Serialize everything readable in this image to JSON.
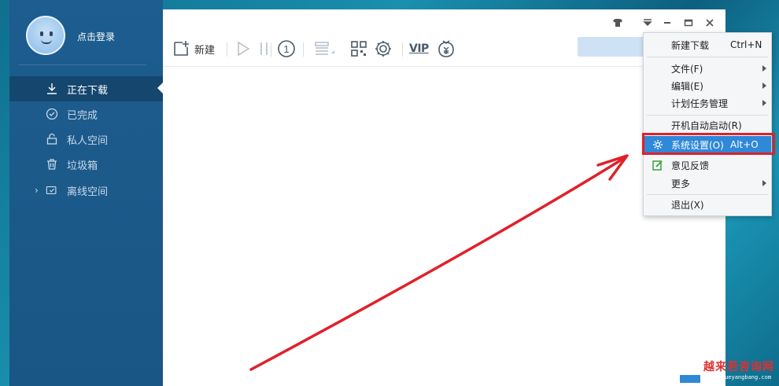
{
  "sidebar": {
    "login_text": "点击登录",
    "items": [
      {
        "label": "正在下载",
        "icon": "download-icon",
        "active": true
      },
      {
        "label": "已完成",
        "icon": "check-circle-icon"
      },
      {
        "label": "私人空间",
        "icon": "lock-icon"
      },
      {
        "label": "垃圾箱",
        "icon": "trash-icon"
      },
      {
        "label": "离线空间",
        "icon": "cloud-icon",
        "expandable": true
      }
    ]
  },
  "toolbar": {
    "new_label": "新建",
    "vip_label": "VIP",
    "limit_label": "1"
  },
  "menu": {
    "items": [
      {
        "label": "新建下载",
        "shortcut": "Ctrl+N"
      },
      {
        "label": "文件(F)",
        "submenu": true
      },
      {
        "label": "编辑(E)",
        "submenu": true
      },
      {
        "label": "计划任务管理",
        "submenu": true
      },
      {
        "label": "开机自动启动(R)"
      },
      {
        "label": "系统设置(O)",
        "shortcut": "Alt+O",
        "highlighted": true,
        "icon": "gear-icon"
      },
      {
        "label": "意见反馈",
        "icon": "edit-icon"
      },
      {
        "label": "更多",
        "submenu": true
      },
      {
        "label": "退出(X)"
      }
    ]
  },
  "watermark": {
    "text": "越来若咨询网",
    "url": "www.yueyangbang.com"
  },
  "colors": {
    "sidebar": "#1d5d8f",
    "highlight": "#2f88d8",
    "annotation": "#e0202a"
  }
}
